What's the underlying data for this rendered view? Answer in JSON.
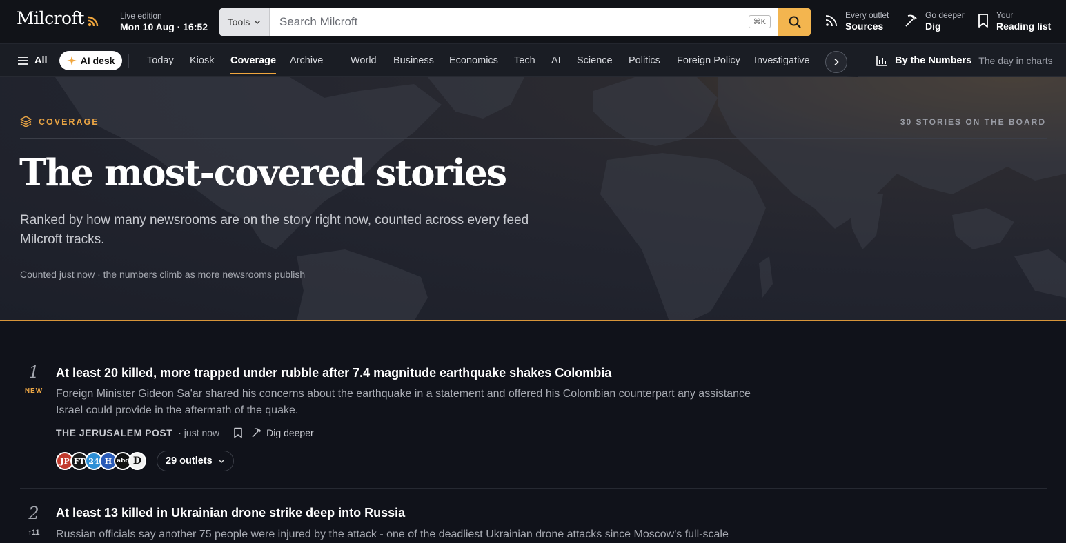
{
  "header": {
    "logo": "Milcroft",
    "edition_label": "Live edition",
    "edition_time": "Mon 10 Aug · 16:52",
    "tools_label": "Tools",
    "search_placeholder": "Search Milcroft",
    "shortcut": "⌘K",
    "nav": [
      {
        "kicker": "Every outlet",
        "label": "Sources",
        "icon": "rss-icon"
      },
      {
        "kicker": "Go deeper",
        "label": "Dig",
        "icon": "pickaxe-icon"
      },
      {
        "kicker": "Your",
        "label": "Reading list",
        "icon": "bookmark-icon"
      }
    ]
  },
  "sections": {
    "all_label": "All",
    "ai_desk_label": "AI desk",
    "primary": [
      "Today",
      "Kiosk",
      "Coverage",
      "Archive"
    ],
    "active": "Coverage",
    "topics": [
      "World",
      "Business",
      "Economics",
      "Tech",
      "AI",
      "Science",
      "Politics",
      "Foreign Policy",
      "Investigative"
    ],
    "numbers_label": "By the Numbers",
    "numbers_sub": "The day in charts"
  },
  "hero": {
    "eyebrow": "COVERAGE",
    "count_label": "30 STORIES ON THE BOARD",
    "title": "The most-covered stories",
    "subtitle": "Ranked by how many newsrooms are on the story right now, counted across every feed Milcroft tracks.",
    "note": "Counted just now · the numbers climb as more newsrooms publish"
  },
  "stories": [
    {
      "rank": "1",
      "badge": "NEW",
      "title": "At least 20 killed, more trapped under rubble after 7.4 magnitude earthquake shakes Colombia",
      "desc": "Foreign Minister Gideon Sa'ar shared his concerns about the earthquake in a statement and offered his Colombian counterpart any assistance Israel could provide in the aftermath of the quake.",
      "source": "THE JERUSALEM POST",
      "time": "· just now",
      "dig_label": "Dig deeper",
      "outlets_label": "29 outlets",
      "outlet_logos": [
        {
          "text": "JP",
          "color": "#c23b2e"
        },
        {
          "text": "FT",
          "color": "#1a1a1a"
        },
        {
          "text": "24",
          "color": "#2d8fd6"
        },
        {
          "text": "H",
          "color": "#2a5bb8"
        },
        {
          "text": "abc",
          "color": "#111111"
        },
        {
          "text": "D",
          "color": "#f2f2f2"
        }
      ]
    },
    {
      "rank": "2",
      "badge": "↑11",
      "title": "At least 13 killed in Ukrainian drone strike deep into Russia",
      "desc": "Russian officials say another 75 people were injured by the attack - one of the deadliest Ukrainian drone attacks since Moscow's full-scale"
    }
  ]
}
